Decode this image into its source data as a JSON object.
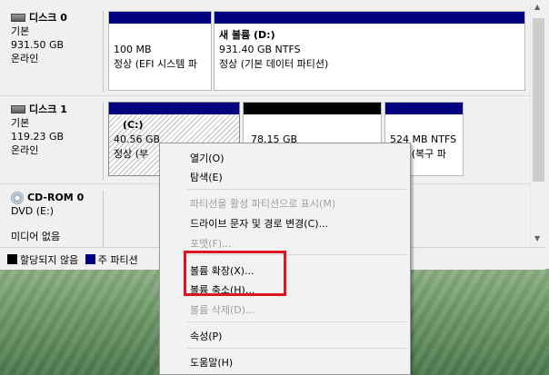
{
  "colors": {
    "primary_partition": "#000080",
    "unallocated": "#000000",
    "highlight_box": "#e0141e"
  },
  "disks": [
    {
      "icon": "disk-icon",
      "title": "디스크 0",
      "type": "기본",
      "size": "931.50 GB",
      "status": "온라인",
      "partitions": [
        {
          "name": "",
          "size": "100 MB",
          "status": "정상 (EFI 시스템 파"
        },
        {
          "name": "새 볼륨  (D:)",
          "size": "931.40 GB NTFS",
          "status": "정상 (기본 데이터 파티션)"
        }
      ]
    },
    {
      "icon": "disk-icon",
      "title": "디스크 1",
      "type": "기본",
      "size": "119.23 GB",
      "status": "온라인",
      "partitions": [
        {
          "name": "(C:)",
          "size": "40.56 GB NTFS",
          "status": "정상 (부"
        },
        {
          "name": "",
          "size": "78.15 GB",
          "status": ""
        },
        {
          "name": "",
          "size": "524 MB NTFS",
          "status": "정상 (복구 파"
        }
      ]
    },
    {
      "icon": "cdrom-icon",
      "title": "CD-ROM 0",
      "type": "DVD (E:)",
      "size": "",
      "status": "미디어 없음"
    }
  ],
  "legend": [
    {
      "label": "할당되지 않음",
      "color": "#000000"
    },
    {
      "label": "주 파티션",
      "color": "#000080"
    }
  ],
  "context_menu": {
    "items": [
      {
        "label": "열기(O)",
        "enabled": true
      },
      {
        "label": "탐색(E)",
        "enabled": true
      },
      {
        "label": "파티션을 활성 파티션으로 표시(M)",
        "enabled": false
      },
      {
        "label": "드라이브 문자 및 경로 변경(C)...",
        "enabled": true
      },
      {
        "label": "포맷(F)...",
        "enabled": false
      },
      {
        "label": "볼륨 확장(X)...",
        "enabled": true
      },
      {
        "label": "볼륨 축소(H)...",
        "enabled": true
      },
      {
        "label": "볼륨 삭제(D)...",
        "enabled": false
      },
      {
        "label": "속성(P)",
        "enabled": true
      },
      {
        "label": "도움말(H)",
        "enabled": true
      }
    ]
  }
}
